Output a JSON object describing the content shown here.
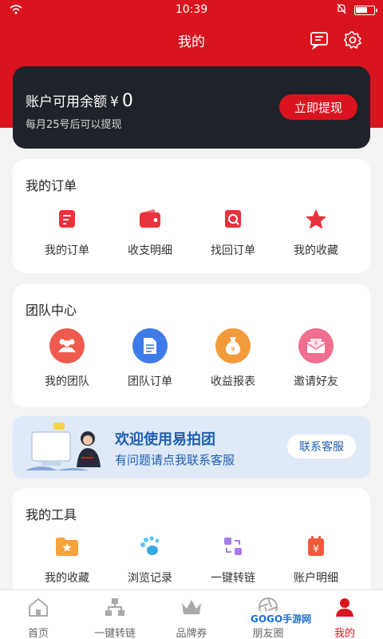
{
  "status_bar": {
    "time": "10:39"
  },
  "header": {
    "title": "我的"
  },
  "balance": {
    "label": "账户可用余额",
    "currency": "¥",
    "amount": "0",
    "note": "每月25号后可以提现",
    "withdraw_label": "立即提现"
  },
  "orders": {
    "title": "我的订单",
    "items": [
      {
        "label": "我的订单",
        "icon": "order-list-icon"
      },
      {
        "label": "收支明细",
        "icon": "wallet-icon"
      },
      {
        "label": "找回订单",
        "icon": "search-order-icon"
      },
      {
        "label": "我的收藏",
        "icon": "star-icon"
      }
    ]
  },
  "team": {
    "title": "团队中心",
    "items": [
      {
        "label": "我的团队",
        "icon": "team-icon"
      },
      {
        "label": "团队订单",
        "icon": "document-icon"
      },
      {
        "label": "收益报表",
        "icon": "money-bag-icon"
      },
      {
        "label": "邀请好友",
        "icon": "invite-envelope-icon"
      }
    ]
  },
  "banner": {
    "line1": "欢迎使用易拍团",
    "line2": "有问题请点我联系客服",
    "button": "联系客服"
  },
  "tools": {
    "title": "我的工具",
    "items": [
      {
        "label": "我的收藏",
        "icon": "folder-star-icon"
      },
      {
        "label": "浏览记录",
        "icon": "footprint-icon"
      },
      {
        "label": "一键转链",
        "icon": "convert-link-icon"
      },
      {
        "label": "账户明细",
        "icon": "account-detail-icon"
      }
    ]
  },
  "tabbar": {
    "items": [
      {
        "label": "首页",
        "icon": "home-icon"
      },
      {
        "label": "一键转链",
        "icon": "network-icon"
      },
      {
        "label": "品牌券",
        "icon": "crown-icon"
      },
      {
        "label": "朋友圈",
        "icon": "aperture-icon"
      },
      {
        "label": "我的",
        "icon": "person-icon"
      }
    ],
    "active": "我的"
  },
  "watermark": "GOGO手游网",
  "colors": {
    "brand_red": "#d9141f",
    "dark_card": "#1f2228",
    "banner_blue": "#1c5fb0"
  }
}
